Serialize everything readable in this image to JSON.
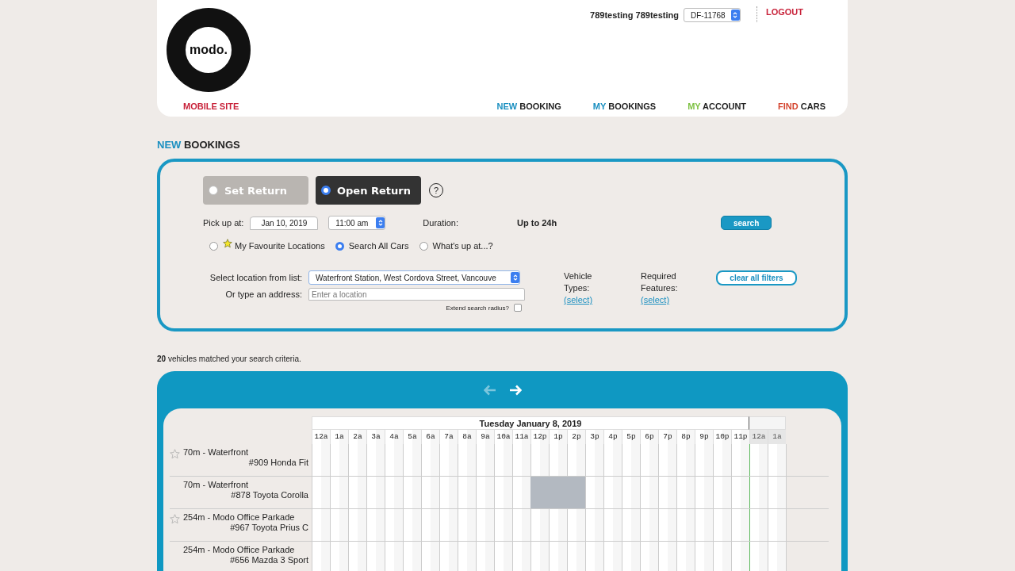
{
  "header": {
    "logo_text": "modo.",
    "user_name": "789testing 789testing",
    "account_select": "DF-11768",
    "logout": "LOGOUT",
    "mobile_site": "MOBILE SITE",
    "nav": [
      {
        "first": "NEW",
        "rest": "BOOKING",
        "color": "#1a8fc0"
      },
      {
        "first": "MY",
        "rest": "BOOKINGS",
        "color": "#1a8fc0"
      },
      {
        "first": "MY",
        "rest": "ACCOUNT",
        "color": "#7dc142"
      },
      {
        "first": "FIND",
        "rest": "CARS",
        "color": "#d4452f"
      }
    ]
  },
  "page_title": {
    "first": "NEW",
    "rest": "BOOKINGS"
  },
  "return_modes": [
    {
      "label": "Set Return",
      "selected": false
    },
    {
      "label": "Open Return",
      "selected": true
    }
  ],
  "help": "?",
  "pickup": {
    "label": "Pick up at:",
    "date": "Jan 10, 2019",
    "time": "11:00 am",
    "duration_label": "Duration:",
    "duration": "Up to 24h"
  },
  "search_button": "search",
  "search_modes": [
    {
      "label": "My Favourite Locations",
      "selected": false,
      "kind": "favourite"
    },
    {
      "label": "Search All Cars",
      "selected": true,
      "kind": "plain"
    },
    {
      "label": "What's up at...?",
      "selected": false,
      "kind": "plain"
    }
  ],
  "location": {
    "list_label": "Select location from list:",
    "list_value": "Waterfront Station, West Cordova Street, Vancouve",
    "address_label": "Or type an address:",
    "address_placeholder": "Enter a location",
    "extend_label": "Extend search radius?",
    "extend_checked": false
  },
  "filters": [
    {
      "label": "Vehicle Types:",
      "link": "(select)"
    },
    {
      "label": "Required Features:",
      "link": "(select)"
    }
  ],
  "clear_filters": "clear all filters",
  "results": "**20** vehicles matched your search criteria.",
  "schedule": {
    "prev_enabled": false,
    "next_enabled": true,
    "date": "Tuesday January 8, 2019",
    "hours": [
      {
        "label": "12a",
        "next_day": false
      },
      {
        "label": "1a",
        "next_day": false
      },
      {
        "label": "2a",
        "next_day": false
      },
      {
        "label": "3a",
        "next_day": false
      },
      {
        "label": "4a",
        "next_day": false
      },
      {
        "label": "5a",
        "next_day": false
      },
      {
        "label": "6a",
        "next_day": false
      },
      {
        "label": "7a",
        "next_day": false
      },
      {
        "label": "8a",
        "next_day": false
      },
      {
        "label": "9a",
        "next_day": false
      },
      {
        "label": "10a",
        "next_day": false
      },
      {
        "label": "11a",
        "next_day": false
      },
      {
        "label": "12p",
        "next_day": false
      },
      {
        "label": "1p",
        "next_day": false
      },
      {
        "label": "2p",
        "next_day": false
      },
      {
        "label": "3p",
        "next_day": false
      },
      {
        "label": "4p",
        "next_day": false
      },
      {
        "label": "5p",
        "next_day": false
      },
      {
        "label": "6p",
        "next_day": false
      },
      {
        "label": "7p",
        "next_day": false
      },
      {
        "label": "8p",
        "next_day": false
      },
      {
        "label": "9p",
        "next_day": false
      },
      {
        "label": "10p",
        "next_day": false
      },
      {
        "label": "11p",
        "next_day": false
      },
      {
        "label": "12a",
        "next_day": true
      },
      {
        "label": "1a",
        "next_day": true
      }
    ],
    "rows": [
      {
        "location": "70m - Waterfront",
        "vehicle": "#909 Honda Fit",
        "star": true,
        "booked": [
          false,
          false,
          false,
          false,
          false,
          false,
          false,
          false,
          false,
          false,
          false,
          false,
          false,
          false,
          false,
          false,
          false,
          false,
          false,
          false,
          false,
          false,
          false,
          false,
          false,
          false
        ]
      },
      {
        "location": "70m - Waterfront",
        "vehicle": "#878 Toyota Corolla",
        "star": false,
        "booked": [
          false,
          false,
          false,
          false,
          false,
          false,
          false,
          false,
          false,
          false,
          false,
          false,
          true,
          true,
          true,
          false,
          false,
          false,
          false,
          false,
          false,
          false,
          false,
          false,
          false,
          false
        ]
      },
      {
        "location": "254m - Modo Office Parkade",
        "vehicle": "#967 Toyota Prius C",
        "star": true,
        "booked": [
          false,
          false,
          false,
          false,
          false,
          false,
          false,
          false,
          false,
          false,
          false,
          false,
          false,
          false,
          false,
          false,
          false,
          false,
          false,
          false,
          false,
          false,
          false,
          false,
          false,
          false
        ]
      },
      {
        "location": "254m - Modo Office Parkade",
        "vehicle": "#656 Mazda 3 Sport",
        "star": false,
        "booked": [
          false,
          false,
          false,
          false,
          false,
          false,
          false,
          false,
          false,
          false,
          false,
          false,
          false,
          false,
          false,
          false,
          false,
          false,
          false,
          false,
          false,
          false,
          false,
          false,
          false,
          false
        ]
      }
    ]
  }
}
